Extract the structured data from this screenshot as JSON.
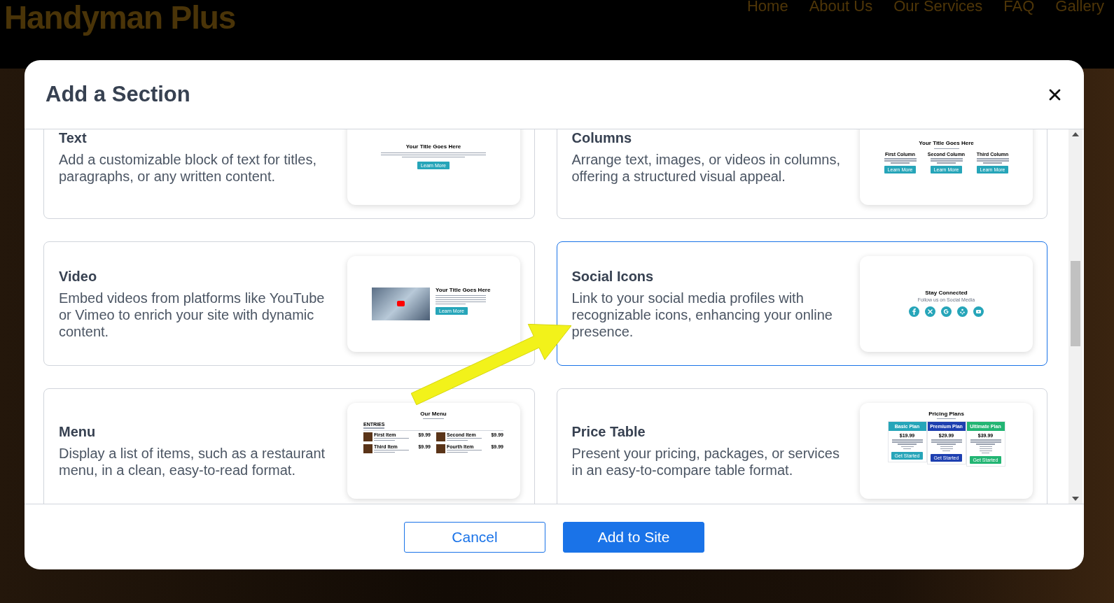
{
  "site": {
    "logo": "Handyman Plus",
    "nav": [
      {
        "label": "Home"
      },
      {
        "label": "About Us"
      },
      {
        "label": "Our Services"
      },
      {
        "label": "FAQ"
      },
      {
        "label": "Gallery"
      }
    ]
  },
  "dialog": {
    "title": "Add a Section",
    "sections": [
      {
        "title": "Text",
        "description": "Add a customizable block of text for titles, paragraphs, or any written content.",
        "selected": false,
        "preview": {
          "kind": "text",
          "title": "Your Title Goes Here",
          "button": "Learn More"
        }
      },
      {
        "title": "Columns",
        "description": "Arrange text, images, or videos in columns, offering a structured visual appeal.",
        "selected": false,
        "preview": {
          "kind": "columns",
          "title": "Your Title Goes Here",
          "columns": [
            {
              "heading": "First Column",
              "button": "Learn More"
            },
            {
              "heading": "Second Column",
              "button": "Learn More"
            },
            {
              "heading": "Third Column",
              "button": "Learn More"
            }
          ]
        }
      },
      {
        "title": "Video",
        "description": "Embed videos from platforms like YouTube or Vimeo to enrich your site with dynamic content.",
        "selected": false,
        "preview": {
          "kind": "video",
          "title": "Your Title Goes Here",
          "button": "Learn More"
        }
      },
      {
        "title": "Social Icons",
        "description": "Link to your social media profiles with recognizable icons, enhancing your online presence.",
        "selected": true,
        "preview": {
          "kind": "social",
          "title": "Stay Connected",
          "subtitle": "Follow us on Social Media"
        }
      },
      {
        "title": "Menu",
        "description": "Display a list of items, such as a restaurant menu, in a clean, easy-to-read format.",
        "selected": false,
        "preview": {
          "kind": "menu",
          "title": "Our Menu",
          "category": "ENTRIES",
          "items": [
            {
              "name": "First Item",
              "price": "$9.99"
            },
            {
              "name": "Second Item",
              "price": "$9.99"
            },
            {
              "name": "Third Item",
              "price": "$9.99"
            },
            {
              "name": "Fourth Item",
              "price": "$9.99"
            }
          ]
        }
      },
      {
        "title": "Price Table",
        "description": "Present your pricing, packages, or services in an easy-to-compare table format.",
        "selected": false,
        "preview": {
          "kind": "pricing",
          "title": "Pricing Plans",
          "plans": [
            {
              "name": "Basic Plan",
              "price": "$19.99",
              "color": "#26a5b9",
              "button": "Get Started"
            },
            {
              "name": "Premium Plan",
              "price": "$29.99",
              "color": "#1d3fb0",
              "button": "Get Started"
            },
            {
              "name": "Ultimate Plan",
              "price": "$39.99",
              "color": "#22b573",
              "button": "Get Started"
            }
          ]
        }
      }
    ],
    "buttons": [
      {
        "label": "Cancel",
        "kind": "secondary"
      },
      {
        "label": "Add to Site",
        "kind": "primary"
      }
    ]
  }
}
